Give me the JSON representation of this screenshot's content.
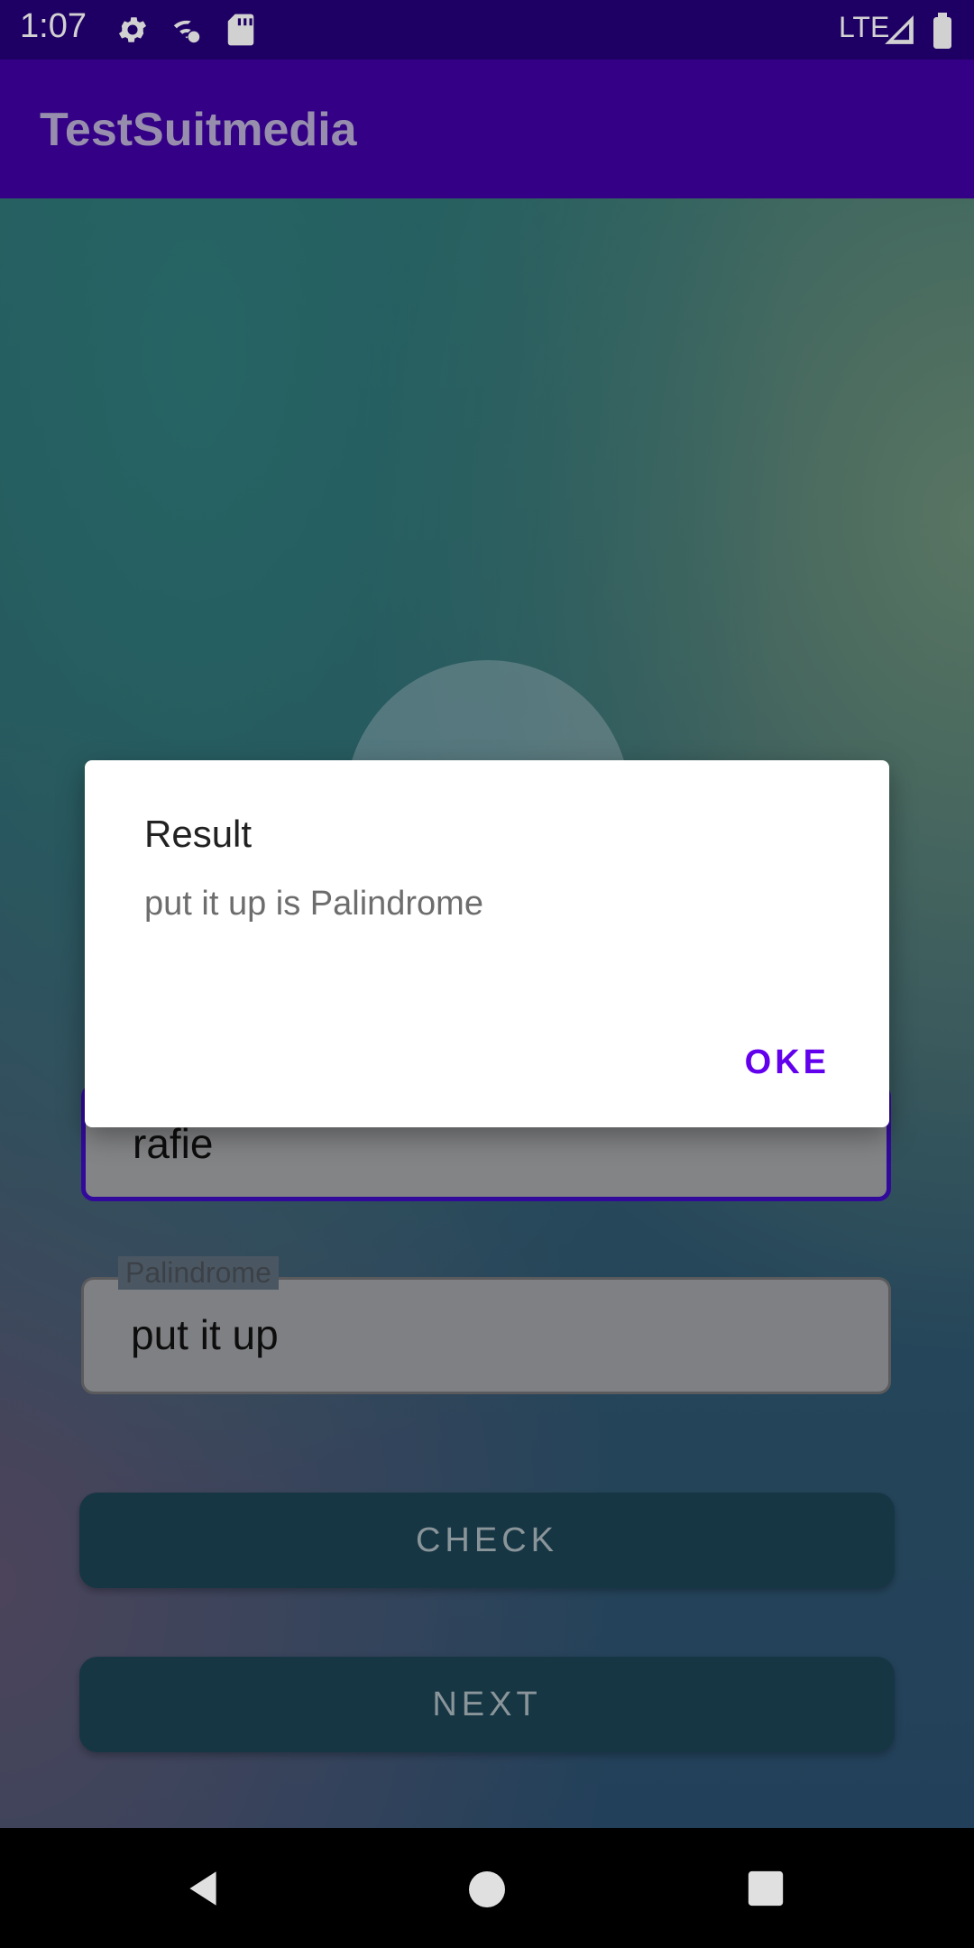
{
  "status_bar": {
    "time": "1:07",
    "network": "LTE",
    "icons": [
      "gear-icon",
      "wifi-off-icon",
      "sd-card-icon",
      "signal-icon",
      "battery-icon"
    ]
  },
  "app_bar": {
    "title": "TestSuitmedia"
  },
  "form": {
    "name_value": "rafie",
    "palindrome_label": "Palindrome",
    "palindrome_value": "put it up",
    "check_label": "CHECK",
    "next_label": "NEXT"
  },
  "dialog": {
    "title": "Result",
    "message": "put it up is Palindrome",
    "ok_label": "OKE"
  },
  "nav_bar": {
    "icons": [
      "back-icon",
      "home-icon",
      "recents-icon"
    ]
  },
  "colors": {
    "status_bar": "#25017b",
    "app_bar": "#3f00a4",
    "dialog_accent": "#6200ee",
    "button_bg": "#1d4254"
  }
}
